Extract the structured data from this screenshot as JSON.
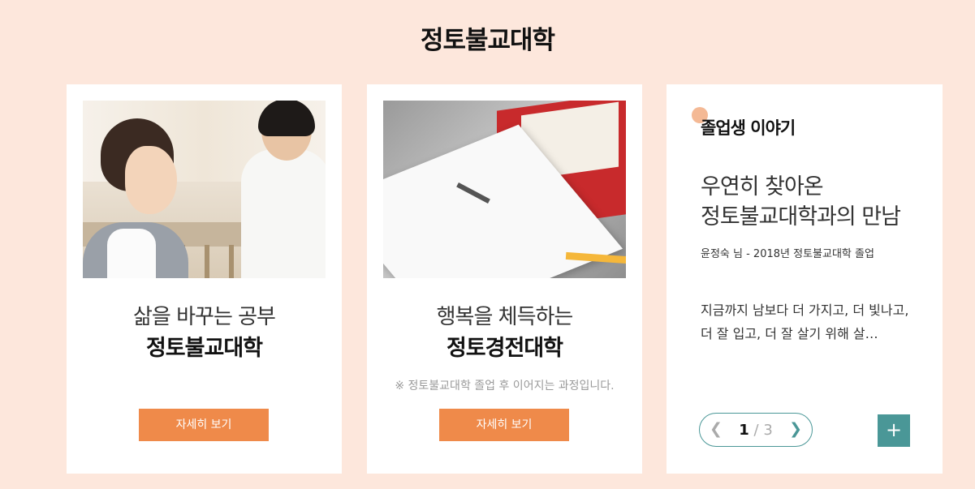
{
  "page_title": "정토불교대학",
  "cards": [
    {
      "line1": "삶을 바꾸는 공부",
      "line2": "정토불교대학",
      "note": "",
      "button": "자세히 보기"
    },
    {
      "line1": "행복을 체득하는",
      "line2": "정토경전대학",
      "note": "※ 정토불교대학 졸업 후 이어지는 과정입니다.",
      "button": "자세히 보기"
    }
  ],
  "story": {
    "heading": "졸업생 이야기",
    "title_line1": "우연히 찾아온",
    "title_line2": "정토불교대학과의 만남",
    "subtitle": "윤정숙 님 - 2018년 정토불교대학 졸업",
    "excerpt": "지금까지 남보다 더 가지고, 더 빛나고, 더 잘 입고, 더 잘 살기 위해 살…",
    "pager": {
      "current": "1",
      "separator": "/",
      "total": "3"
    },
    "plus_label": "+"
  },
  "colors": {
    "background": "#fde7dc",
    "accent_orange": "#ef8a4a",
    "accent_teal": "#4a9797"
  },
  "icons": [
    "chevron-left-icon",
    "chevron-right-icon",
    "plus-icon"
  ]
}
